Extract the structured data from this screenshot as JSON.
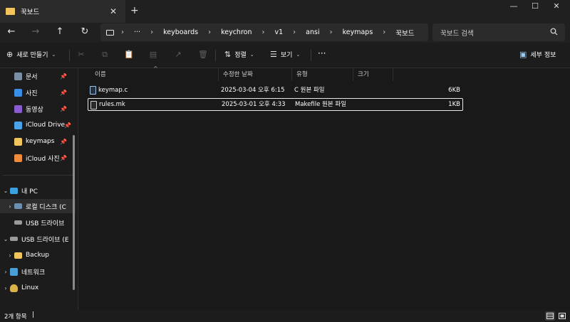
{
  "tab": {
    "title": "꾹보드",
    "close": "✕",
    "new_tab": "+"
  },
  "window_controls": {
    "minimize": "—",
    "maximize": "☐",
    "close": "✕"
  },
  "nav": {
    "back": "←",
    "forward": "→",
    "up": "↑",
    "refresh": "↻"
  },
  "address": {
    "more": "···",
    "separator": "›",
    "crumbs": [
      "keyboards",
      "keychron",
      "v1",
      "ansi",
      "keymaps",
      "꾹보드"
    ]
  },
  "search": {
    "placeholder": "꾹보드 검색",
    "icon": "search-icon"
  },
  "commandbar": {
    "new_label": "새로 만들기",
    "sort_label": "정렬",
    "view_label": "보기",
    "more_label": "···",
    "details_label": "세부 정보"
  },
  "sidebar": {
    "quick_access": [
      {
        "label": "문서",
        "color": "#7a8fa6"
      },
      {
        "label": "사진",
        "color": "#3a8ee6"
      },
      {
        "label": "동영상",
        "color": "#8a5cd1"
      },
      {
        "label": "iCloud Drive",
        "color": "#4aa3e8"
      },
      {
        "label": "keymaps",
        "color": "#f2c55c"
      },
      {
        "label": "iCloud 사진",
        "color": "#f08a3c"
      }
    ],
    "pin_glyph": "📌",
    "tree": [
      {
        "label": "내 PC",
        "chevron": "⌄"
      },
      {
        "label": "로컬 디스크 (C",
        "chevron": "›"
      },
      {
        "label": "USB 드라이브",
        "chevron": ""
      },
      {
        "label": "USB 드라이브 (E",
        "chevron": "⌄"
      },
      {
        "label": "Backup",
        "chevron": "›"
      },
      {
        "label": "네트워크",
        "chevron": "›"
      },
      {
        "label": "Linux",
        "chevron": "›"
      }
    ]
  },
  "columns": {
    "name": "이름",
    "modified": "수정한 날짜",
    "type": "유형",
    "size": "크기"
  },
  "files": [
    {
      "name": "keymap.c",
      "modified": "2025-03-04 오후 6:15",
      "type": "C 원본 파일",
      "size": "6KB"
    },
    {
      "name": "rules.mk",
      "modified": "2025-03-01 오후 4:33",
      "type": "Makefile 원본 파일",
      "size": "1KB"
    }
  ],
  "status": {
    "count": "2개 항목",
    "caret": "|"
  }
}
